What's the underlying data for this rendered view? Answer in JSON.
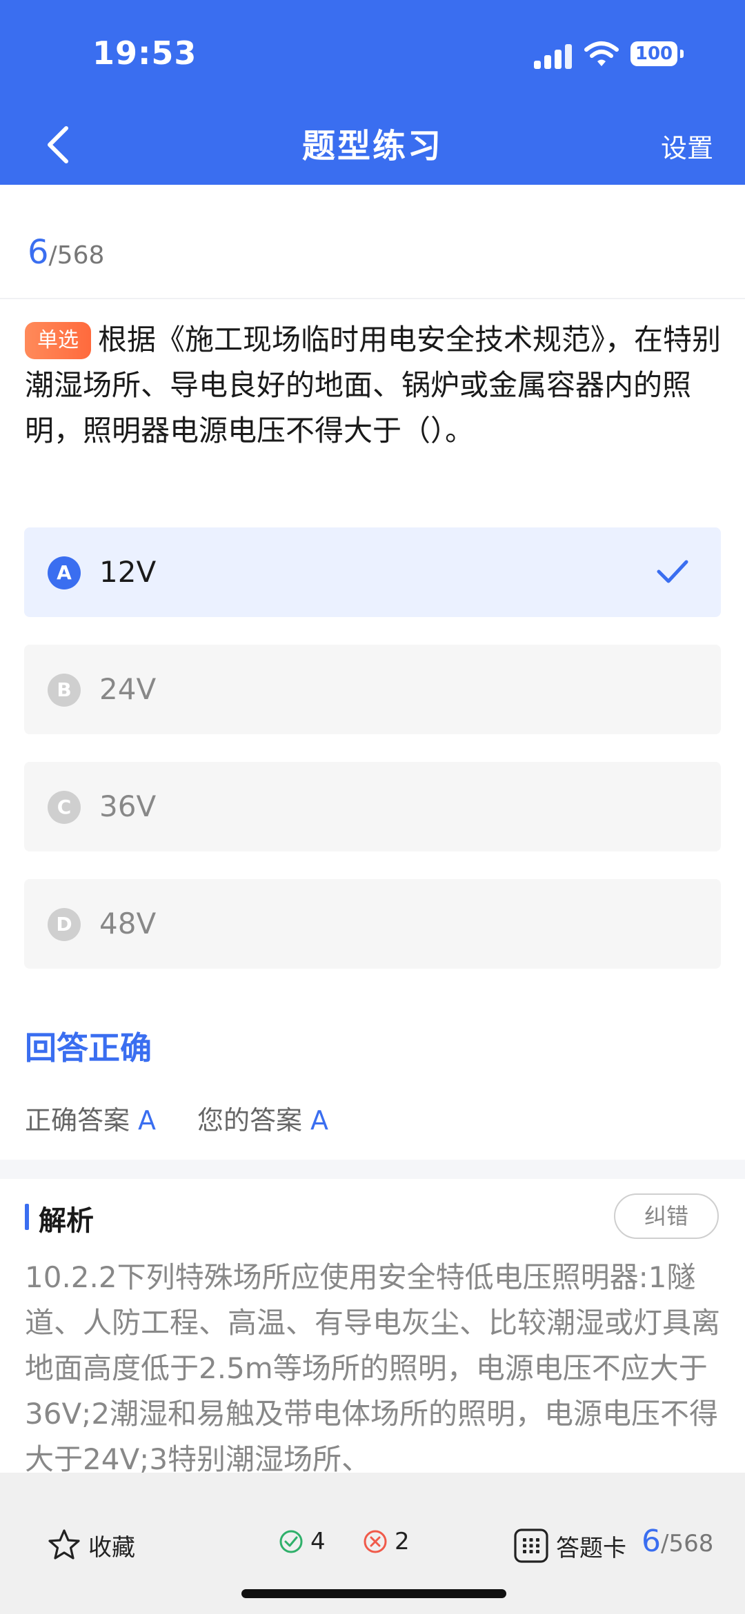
{
  "status_bar": {
    "time": "19:53",
    "battery": "100"
  },
  "header": {
    "title": "题型练习",
    "settings_label": "设置"
  },
  "progress": {
    "current": "6",
    "total": "/568"
  },
  "question": {
    "type_label": "单选",
    "text": "根据《施工现场临时用电安全技术规范》，在特别潮湿场所、导电良好的地面、锅炉或金属容器内的照明，照明器电源电压不得大于（）。"
  },
  "options": [
    {
      "letter": "A",
      "text": "12V",
      "selected": true
    },
    {
      "letter": "B",
      "text": "24V",
      "selected": false
    },
    {
      "letter": "C",
      "text": "36V",
      "selected": false
    },
    {
      "letter": "D",
      "text": "48V",
      "selected": false
    }
  ],
  "result": {
    "title": "回答正确",
    "correct_label": "正确答案",
    "correct_value": "A",
    "your_label": "您的答案",
    "your_value": "A"
  },
  "analysis": {
    "title": "解析",
    "report_label": "纠错",
    "text": "10.2.2下列特殊场所应使用安全特低电压照明器:1隧道、人防工程、高温、有导电灰尘、比较潮湿或灯具离地面高度低于2.5m等场所的照明，电源电压不应大于36V;2潮湿和易触及带电体场所的照明，电源电压不得大于24V;3特别潮湿场所、"
  },
  "bottom_bar": {
    "favorite_label": "收藏",
    "correct_count": "4",
    "wrong_count": "2",
    "answer_card_label": "答题卡",
    "progress_current": "6",
    "progress_total": "/568"
  },
  "colors": {
    "accent": "#3a6ef0",
    "tag": "#ff7a4a",
    "correct": "#2fb06a",
    "wrong": "#f05a4a"
  },
  "icons": [
    "back-icon",
    "signal-icon",
    "wifi-icon",
    "battery-icon",
    "check-icon",
    "star-icon",
    "correct-circle-icon",
    "wrong-circle-icon",
    "grid-icon"
  ]
}
